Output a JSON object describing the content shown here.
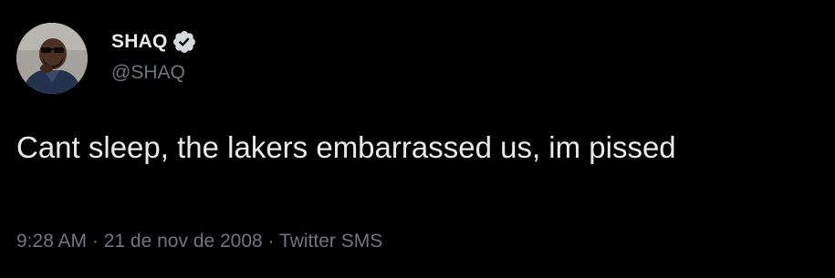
{
  "author": {
    "display_name": "SHAQ",
    "handle": "@SHAQ",
    "verified_icon": "verified-badge-icon",
    "avatar_icon": "profile-avatar"
  },
  "tweet": {
    "text": "Cant sleep, the lakers embarrassed us, im pissed"
  },
  "meta": {
    "time": "9:28 AM",
    "separator_1": " · ",
    "date": "21 de nov de 2008",
    "separator_2": " · ",
    "source": "Twitter SMS"
  },
  "colors": {
    "background": "#000000",
    "primary_text": "#e7e9ea",
    "secondary_text": "#71767b"
  }
}
